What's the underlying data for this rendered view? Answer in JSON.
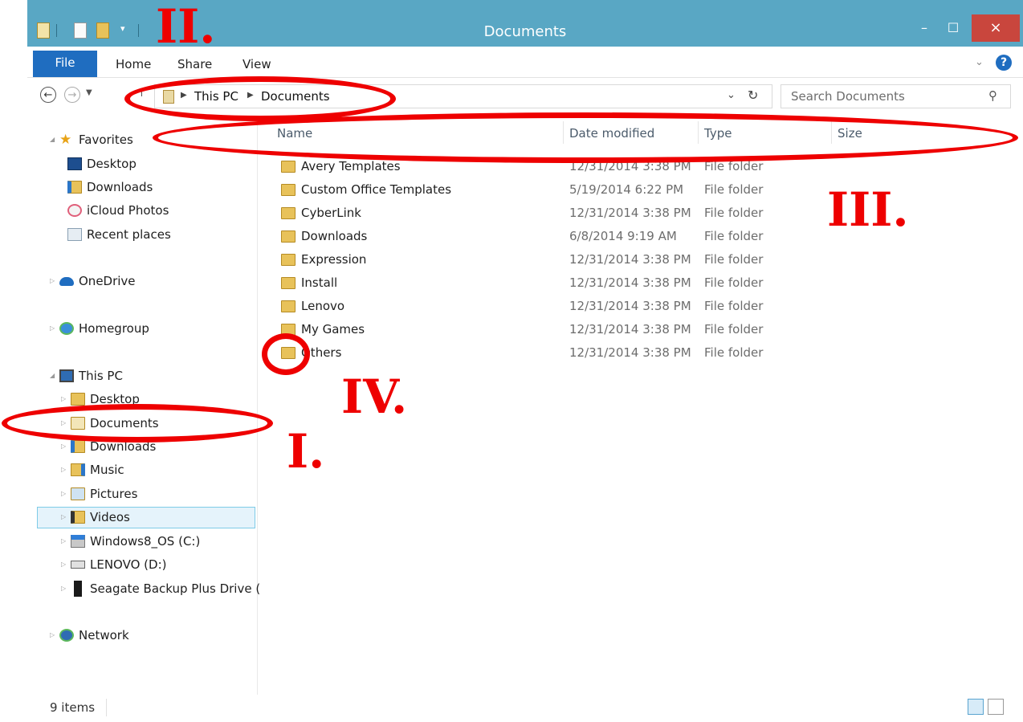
{
  "window": {
    "title": "Documents",
    "buttons": {
      "minimize": "–",
      "maximize": "☐",
      "close": "×"
    }
  },
  "ribbon": {
    "tabs": [
      "File",
      "Home",
      "Share",
      "View"
    ],
    "help": "?"
  },
  "address": {
    "crumbs": [
      "This PC",
      "Documents"
    ]
  },
  "search": {
    "placeholder": "Search Documents"
  },
  "nav": {
    "favorites": "Favorites",
    "favorites_items": [
      "Desktop",
      "Downloads",
      "iCloud Photos",
      "Recent places"
    ],
    "onedrive": "OneDrive",
    "homegroup": "Homegroup",
    "thispc": "This PC",
    "thispc_items": [
      "Desktop",
      "Documents",
      "Downloads",
      "Music",
      "Pictures",
      "Videos",
      "Windows8_OS (C:)",
      "LENOVO (D:)",
      "Seagate Backup Plus Drive ("
    ],
    "network": "Network"
  },
  "columns": [
    "Name",
    "Date modified",
    "Type",
    "Size"
  ],
  "files": [
    {
      "name": "Avery Templates",
      "date": "12/31/2014 3:38 PM",
      "type": "File folder"
    },
    {
      "name": "Custom Office Templates",
      "date": "5/19/2014 6:22 PM",
      "type": "File folder"
    },
    {
      "name": "CyberLink",
      "date": "12/31/2014 3:38 PM",
      "type": "File folder"
    },
    {
      "name": "Downloads",
      "date": "6/8/2014 9:19 AM",
      "type": "File folder"
    },
    {
      "name": "Expression",
      "date": "12/31/2014 3:38 PM",
      "type": "File folder"
    },
    {
      "name": "Install",
      "date": "12/31/2014 3:38 PM",
      "type": "File folder"
    },
    {
      "name": "Lenovo",
      "date": "12/31/2014 3:38 PM",
      "type": "File folder"
    },
    {
      "name": "My Games",
      "date": "12/31/2014 3:38 PM",
      "type": "File folder"
    },
    {
      "name": "Others",
      "date": "12/31/2014 3:38 PM",
      "type": "File folder"
    }
  ],
  "status": {
    "count": "9 items"
  },
  "annotations": {
    "one": "I.",
    "two": "II.",
    "three": "III.",
    "four": "IV."
  },
  "colors": {
    "titlebar": "#59a7c4",
    "accent": "#1f6dc0",
    "annotation": "#ee0000",
    "close": "#c9463d"
  }
}
